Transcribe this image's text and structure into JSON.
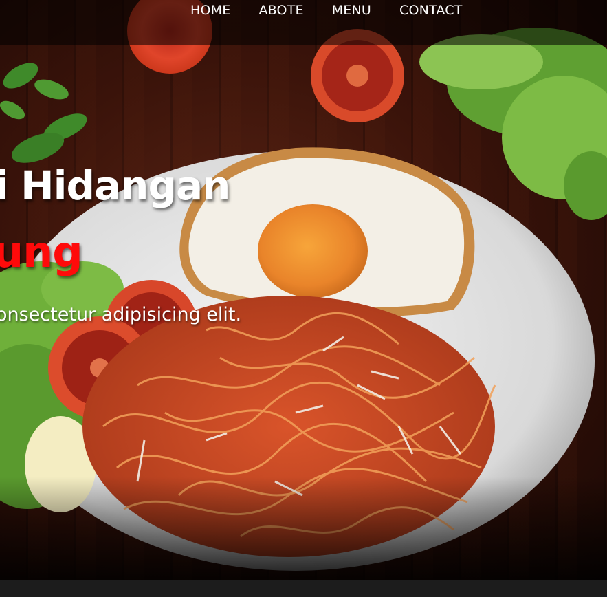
{
  "nav": {
    "items": [
      {
        "label": "HOME"
      },
      {
        "label": "ABOTE"
      },
      {
        "label": "MENU"
      },
      {
        "label": "CONTACT"
      }
    ]
  },
  "hero": {
    "title_line1": "i Hidangan",
    "title_line2": "ung",
    "subtitle": "onsectetur adipisicing elit.",
    "colors": {
      "title": "#ffffff",
      "accent": "#ff0a0a"
    }
  },
  "background_image": "spaghetti-plate-with-fried-egg-tomato-lettuce"
}
